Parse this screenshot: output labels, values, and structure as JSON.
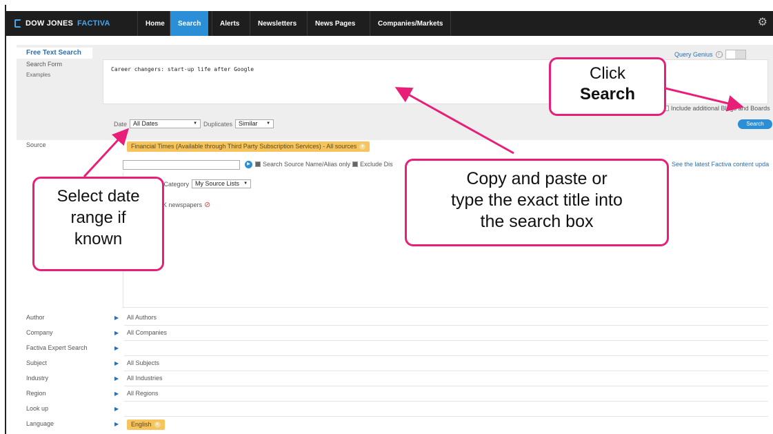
{
  "brand": {
    "name_part1": "DOW JONES",
    "name_part2": "FACTIVA"
  },
  "nav": {
    "tabs": [
      {
        "label": "Home",
        "active": false
      },
      {
        "label": "Search",
        "active": true
      },
      {
        "label": "Alerts",
        "active": false
      },
      {
        "label": "Newsletters",
        "active": false
      },
      {
        "label": "News Pages",
        "active": false
      },
      {
        "label": "Companies/Markets",
        "active": false
      }
    ],
    "settings_icon": "gear-icon"
  },
  "side_menu": {
    "free_text": "Free Text Search",
    "search_form": "Search Form",
    "examples": "Examples"
  },
  "query": {
    "text": "Career changers: start-up life after Google",
    "query_genius_label": "Query Genius",
    "include_label": "Include additional Blogs and Boards"
  },
  "filters": {
    "date_label": "Date",
    "date_value": "All Dates",
    "duplicates_label": "Duplicates",
    "duplicates_value": "Similar",
    "search_button": "Search"
  },
  "source": {
    "label": "Source",
    "chip": "Financial Times (Available through Third Party Subscription Services) - All sources",
    "opt_search_names": "Search Source Name/Alias only",
    "opt_exclude": "Exclude Dis",
    "latest_link": "See the latest Factiva content upda",
    "category_label": "e Category",
    "category_value": "My Source Lists",
    "uk_item": "K newspapers"
  },
  "fields": [
    {
      "label": "Author",
      "value": "All Authors"
    },
    {
      "label": "Company",
      "value": "All Companies"
    },
    {
      "label": "Factiva Expert Search",
      "value": ""
    },
    {
      "label": "Subject",
      "value": "All Subjects"
    },
    {
      "label": "Industry",
      "value": "All Industries"
    },
    {
      "label": "Region",
      "value": "All Regions"
    },
    {
      "label": "Look up",
      "value": ""
    },
    {
      "label": "Language",
      "value": ""
    }
  ],
  "language_chip": "English",
  "callouts": {
    "click_line1": "Click",
    "click_line2": "Search",
    "copy_line1": "Copy and paste or",
    "copy_line2": "type the exact title into",
    "copy_line3": "the search box",
    "date_line1": "Select date",
    "date_line2": "range if",
    "date_line3": "known"
  },
  "colors": {
    "nav_bg": "#1e1e1e",
    "accent": "#2a8fd6",
    "callout_border": "#e91e78",
    "chip": "#f7c35c"
  }
}
